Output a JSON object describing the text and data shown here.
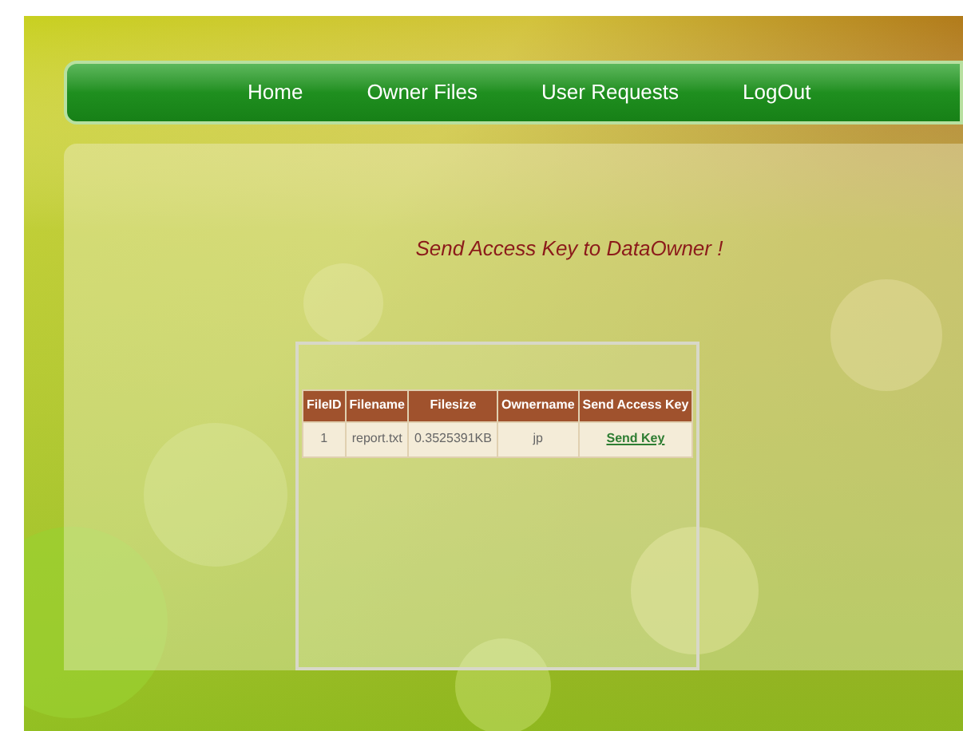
{
  "nav": {
    "items": [
      {
        "label": "Home"
      },
      {
        "label": "Owner Files"
      },
      {
        "label": "User Requests"
      },
      {
        "label": "LogOut"
      }
    ]
  },
  "heading": "Send Access Key to DataOwner !",
  "table": {
    "columns": [
      "FileID",
      "Filename",
      "Filesize",
      "Ownername",
      "Send Access Key"
    ],
    "rows": [
      {
        "cells": [
          "1",
          "report.txt",
          "0.3525391KB",
          "jp"
        ],
        "action": "Send Key"
      }
    ]
  }
}
